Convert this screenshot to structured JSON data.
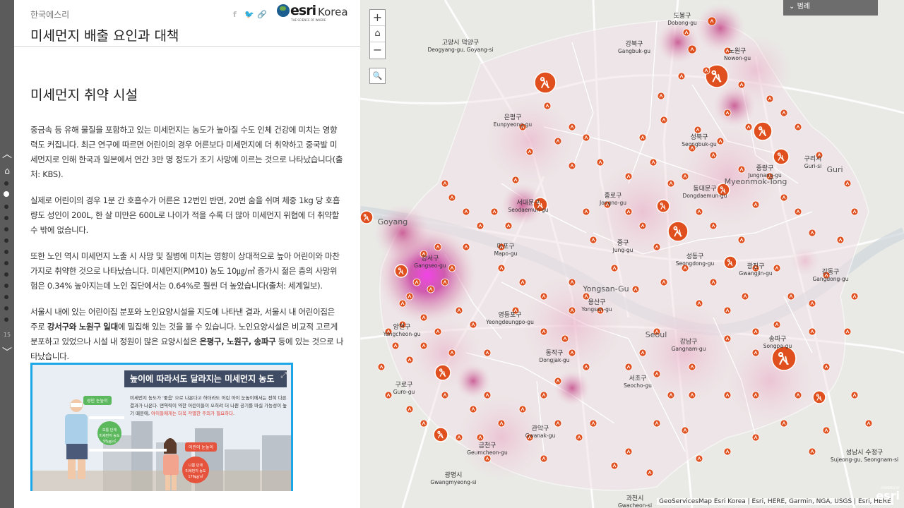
{
  "header": {
    "org": "한국에스리",
    "title": "미세먼지 배출 요인과 대책",
    "logo_brand": "esri",
    "logo_country": "Korea",
    "logo_tagline": "THE SCIENCE OF WHERE"
  },
  "rail": {
    "page_number": "15"
  },
  "content": {
    "section_title": "미세먼지 취약 시설",
    "p1": "중금속 등 유해 물질을 포함하고 있는 미세먼지는 농도가 높아질 수도 인체 건강에 미치는 영향력도 커집니다. 최근 연구에 따르면 어린이의 경우 어른보다 미세먼지에 더 취약하고 중국발 미세먼지로 인해 한국과 일본에서 연간 3만 명 정도가 조기 사망에 이르는 것으로 나타났습니다(출처: KBS).",
    "p2": "실제로 어린이의 경우 1분 간 호흡수가 어른은 12번인 반면, 20번 숨을 쉬며 체중 1kg 당 호흡량도 성인이 200L, 한 살 미만은 600L로 나이가 적을 수록 더 많아 미세먼지 위협에 더 취약할 수 밖에 없습니다.",
    "p3": "또한 노인 역시 미세먼지 노출 시 사망 및 질병에 미치는 영향이 상대적으로 높아 어린이와 마찬가지로 취약한 것으로 나타났습니다. 미세먼지(PM10) 농도 10㎍/㎥ 증가시 젊은 층의 사망위험은 0.34% 높아지는데 노인 집단에서는 0.64%로 훨씬 더 높았습니다(출처: 세계일보).",
    "p4_a": "서울시 내에 있는 어린이집 분포와 노인요양시설을 지도에 나타낸 결과, 서울시 내 어린이집은 주로 ",
    "p4_b": "강서구와 노원구 일대",
    "p4_c": "에 밀집해 있는 것을 볼 수 있습니다. 노인요양시설은 비교적 고르게 분포하고 있었으나 시설 내 정원이 많은 요양시설은 ",
    "p4_d": "은평구, 노원구, 송파구",
    "p4_e": " 등에 있는 것으로 나타났습니다."
  },
  "infographic": {
    "title": "높이에 따라서도 달라지는 미세먼지 농도",
    "text_a": "미세먼지 농도가 '좋음' 으로 나온다고 하더라도 어린 아이 눈높이에서는 전혀 다른 결과가 나온다. 면역력이 약한 어린이들이 오히려 더 나쁜 공기를 마실 가능성이 높기 때문에,",
    "text_b": "아이들에게는 더욱 각별한 주의가 필요하다.",
    "adult_tag": "성인 눈높이",
    "adult_level": "보통 단계",
    "adult_sub": "미세먼지 농도",
    "adult_val": "55㎍/㎥",
    "child_tag": "어린이 눈높이",
    "child_level": "나쁨 단계",
    "child_sub": "미세먼지 농도",
    "child_val": "176㎍/㎥"
  },
  "map": {
    "legend_label": "범례",
    "attribution": "GeoServicesMap Esri Korea | Esri, HERE, Garmin, NGA, USGS | Esri, HERE",
    "watermark": "esri",
    "watermark_tag": "POWERED BY",
    "zoom_in": "+",
    "home": "⌂",
    "zoom_out": "−",
    "search": "🔍",
    "districts": [
      {
        "ko": "도봉구",
        "en": "Dobong-gu"
      },
      {
        "ko": "노원구",
        "en": "Nowon-gu"
      },
      {
        "ko": "강북구",
        "en": "Gangbuk-gu"
      },
      {
        "ko": "고양시 덕양구",
        "en": "Deogyang-gu, Goyang-si"
      },
      {
        "ko": "은평구",
        "en": "Eunpyeong-gu"
      },
      {
        "ko": "성북구",
        "en": "Seongbuk-gu"
      },
      {
        "ko": "중랑구",
        "en": "Jungnang-gu"
      },
      {
        "ko": "구리시",
        "en": "Guri-si"
      },
      {
        "ko": "동대문구",
        "en": "Dongdaemun-gu"
      },
      {
        "ko": "서대문구",
        "en": "Seodaemun-gu"
      },
      {
        "ko": "종로구",
        "en": "Jongno-gu"
      },
      {
        "ko": "마포구",
        "en": "Mapo-gu"
      },
      {
        "ko": "중구",
        "en": "Jung-gu"
      },
      {
        "ko": "성동구",
        "en": "Seongdong-gu"
      },
      {
        "ko": "광진구",
        "en": "Gwangjin-gu"
      },
      {
        "ko": "강동구",
        "en": "Gangdong-gu"
      },
      {
        "ko": "강서구",
        "en": "Gangseo-gu"
      },
      {
        "ko": "용산구",
        "en": "Yongsan-gu"
      },
      {
        "ko": "영등포구",
        "en": "Yeongdeungpo-gu"
      },
      {
        "ko": "양천구",
        "en": "Yangcheon-gu"
      },
      {
        "ko": "동작구",
        "en": "Dongjak-gu"
      },
      {
        "ko": "강남구",
        "en": "Gangnam-gu"
      },
      {
        "ko": "송파구",
        "en": "Songpa-gu"
      },
      {
        "ko": "구로구",
        "en": "Guro-gu"
      },
      {
        "ko": "서초구",
        "en": "Seocho-gu"
      },
      {
        "ko": "관악구",
        "en": "Gwanak-gu"
      },
      {
        "ko": "금천구",
        "en": "Geumcheon-gu"
      },
      {
        "ko": "성남시 수정구",
        "en": "Sujeong-gu, Seongnam-si"
      },
      {
        "ko": "광명시",
        "en": "Gwangmyeong-si"
      },
      {
        "ko": "과천시",
        "en": "Gwacheon-si"
      }
    ],
    "places": [
      "Goyang",
      "Myeonmok-Tong",
      "Guri",
      "Yongsan-Gu",
      "Seoul"
    ],
    "colors": {
      "marker": "#e0501e",
      "heat_light": "#f1c9d6",
      "heat_mid": "#d86aa5",
      "heat_hot": "#e23ce0",
      "map_bg": "#e9e9e6"
    }
  }
}
